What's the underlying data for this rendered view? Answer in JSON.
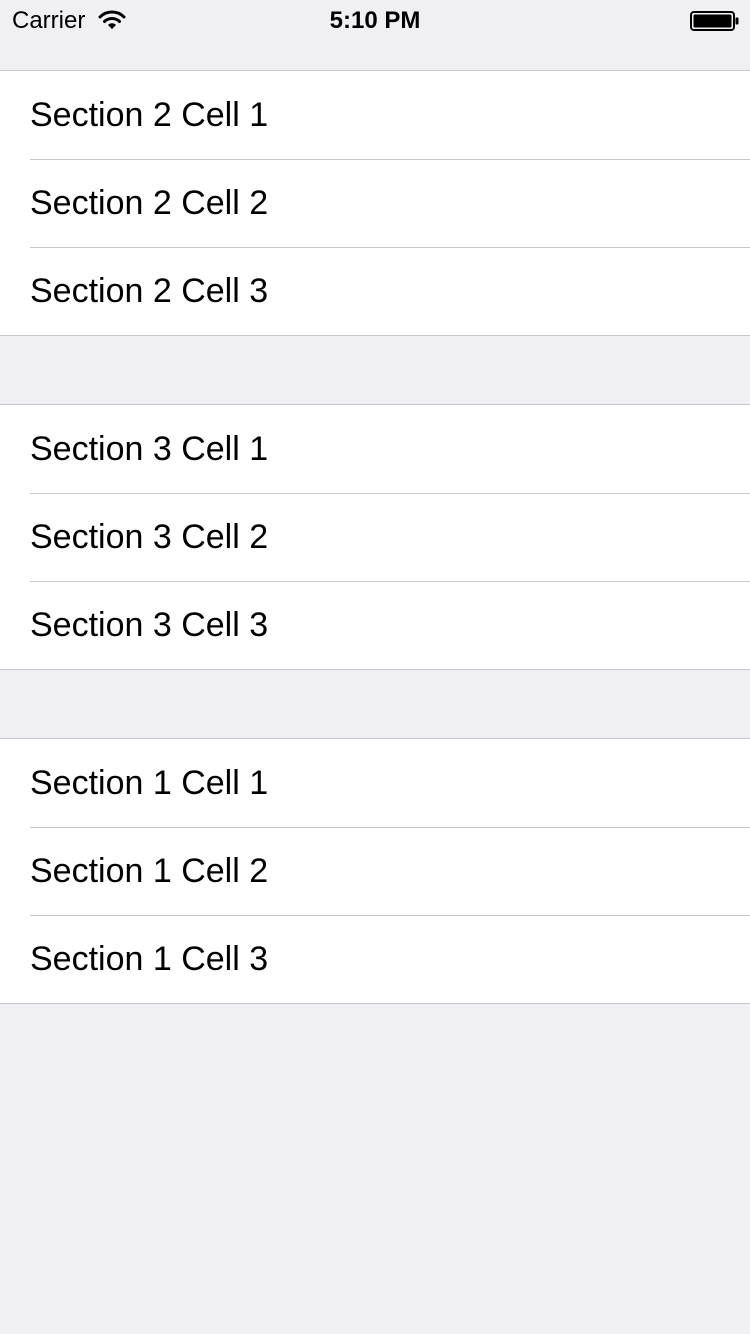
{
  "status_bar": {
    "carrier": "Carrier",
    "time": "5:10 PM",
    "wifi_icon": "wifi-icon",
    "battery_icon": "battery-icon"
  },
  "table": {
    "sections": [
      {
        "cells": [
          "Section 2 Cell 1",
          "Section 2 Cell 2",
          "Section 2 Cell 3"
        ]
      },
      {
        "cells": [
          "Section 3 Cell 1",
          "Section 3 Cell 2",
          "Section 3 Cell 3"
        ]
      },
      {
        "cells": [
          "Section 1 Cell 1",
          "Section 1 Cell 2",
          "Section 1 Cell 3"
        ]
      }
    ]
  },
  "colors": {
    "background": "#efeff4",
    "cell_background": "#ffffff",
    "separator": "#c8c7cc",
    "text": "#000000"
  }
}
